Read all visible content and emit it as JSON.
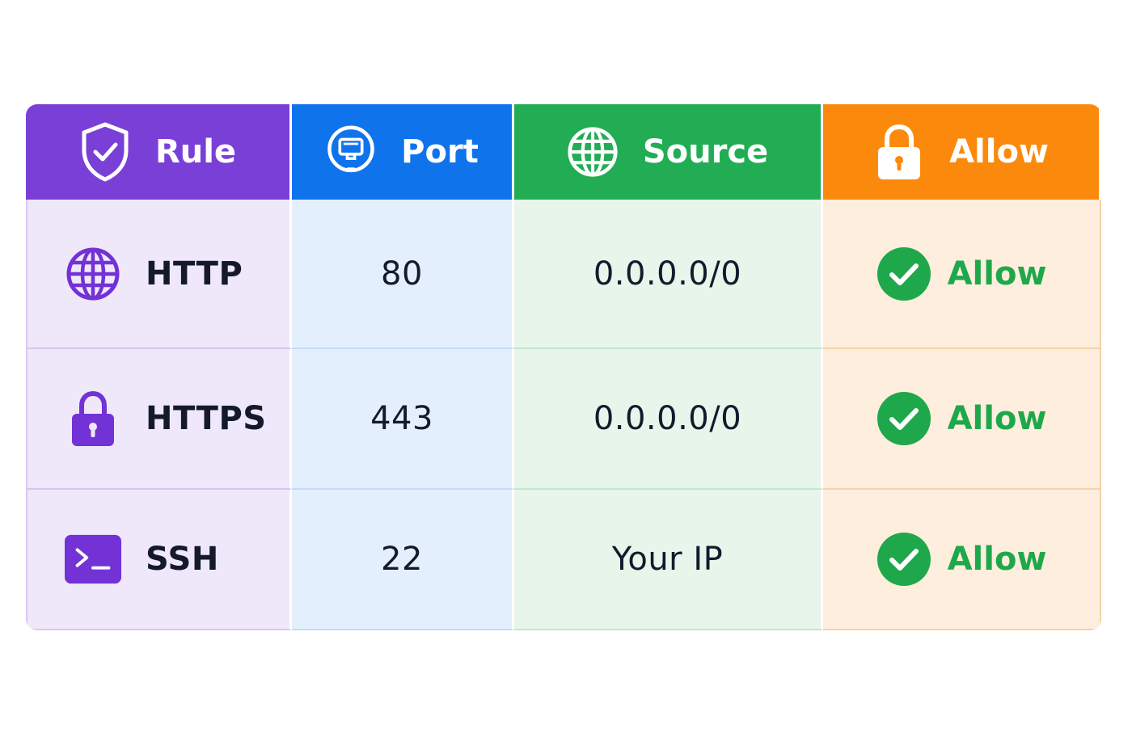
{
  "colors": {
    "rule_header": "#7a3fd7",
    "port_header": "#0f73ec",
    "source_header": "#22ad55",
    "allow_header": "#fb8a0c",
    "allow_text": "#1ea84b"
  },
  "headers": [
    {
      "label": "Rule",
      "icon": "shield-check-icon"
    },
    {
      "label": "Port",
      "icon": "network-port-icon"
    },
    {
      "label": "Source",
      "icon": "globe-icon"
    },
    {
      "label": "Allow",
      "icon": "lock-icon"
    }
  ],
  "rows": [
    {
      "rule": "HTTP",
      "rule_icon": "globe-icon",
      "port": "80",
      "source": "0.0.0.0/0",
      "action": "Allow",
      "action_icon": "check-circle-icon"
    },
    {
      "rule": "HTTPS",
      "rule_icon": "lock-icon",
      "port": "443",
      "source": "0.0.0.0/0",
      "action": "Allow",
      "action_icon": "check-circle-icon"
    },
    {
      "rule": "SSH",
      "rule_icon": "terminal-icon",
      "port": "22",
      "source": "Your IP",
      "action": "Allow",
      "action_icon": "check-circle-icon"
    }
  ]
}
